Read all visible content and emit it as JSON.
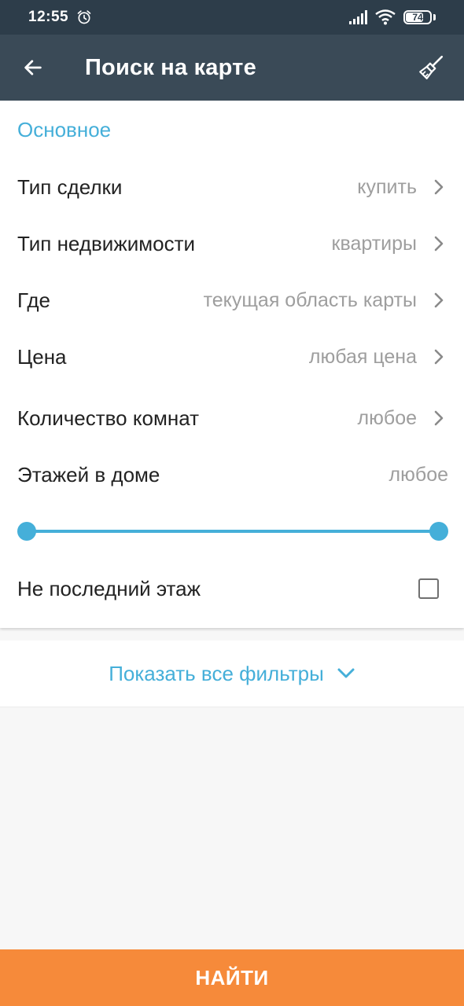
{
  "status_bar": {
    "time": "12:55",
    "battery": "74",
    "battery_level": 0.74,
    "icons": [
      "alarm-icon",
      "signal-icon",
      "wifi-icon",
      "battery-icon"
    ]
  },
  "app_bar": {
    "title": "Поиск на карте",
    "icons": [
      "back-arrow-icon",
      "broom-icon"
    ]
  },
  "filters": {
    "section_title": "Основное",
    "rows": [
      {
        "label": "Тип сделки",
        "value": "купить"
      },
      {
        "label": "Тип недвижимости",
        "value": "квартиры"
      },
      {
        "label": "Где",
        "value": "текущая область карты"
      },
      {
        "label": "Цена",
        "value": "любая цена"
      },
      {
        "label": "Количество комнат",
        "value": "любое"
      }
    ],
    "floors": {
      "label": "Этажей в доме",
      "value": "любое",
      "range_min_fraction": 0,
      "range_max_fraction": 1
    },
    "not_last_floor": {
      "label": "Не последний этаж",
      "checked": false
    }
  },
  "show_all_filters": {
    "label": "Показать все фильтры",
    "icon": "chevron-down-icon"
  },
  "find_button": {
    "label": "НАЙТИ"
  },
  "colors": {
    "status_bar": "#2d3d4a",
    "app_bar": "#3a4a57",
    "accent": "#45afd9",
    "find_button": "#f68a3a",
    "value_text": "#9e9e9e"
  }
}
